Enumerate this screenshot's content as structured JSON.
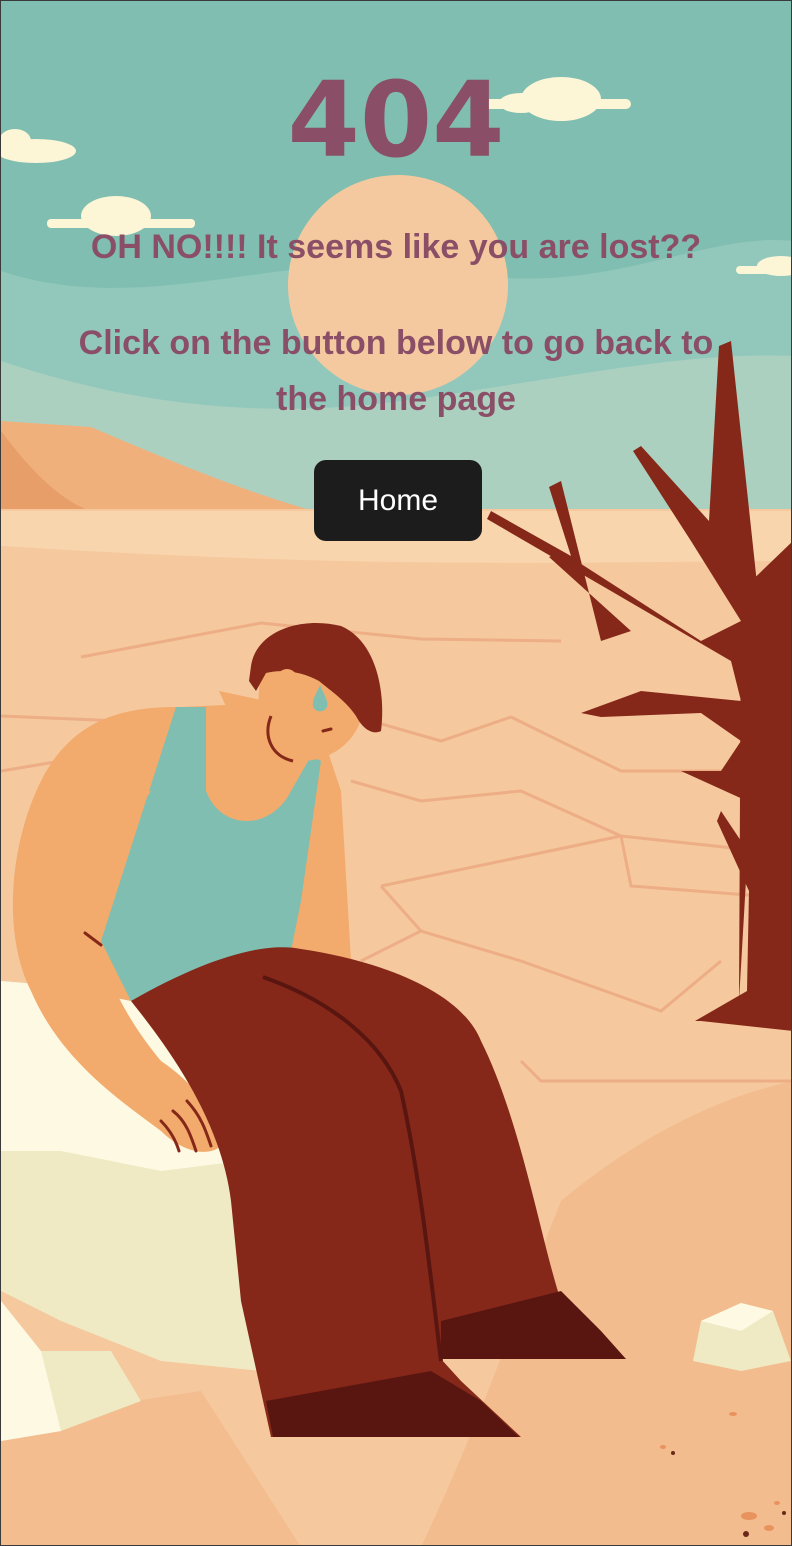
{
  "error": {
    "code": "404",
    "message_lost": "OH NO!!!! It seems like you are lost??",
    "message_instruction": "Click on the button below to go back to the home page"
  },
  "actions": {
    "home_label": "Home"
  },
  "illustration": {
    "subject": "sad-man-sitting-in-desert",
    "colors": {
      "sky": "#7fbeb0",
      "sun": "#f5c9a0",
      "sand": "#f5c89d",
      "dune": "#f0b07c",
      "shirt": "#7fbeb0",
      "pants": "#852819",
      "skin": "#f2ab6c",
      "hair": "#852819",
      "tree": "#852819",
      "rock": "#efe9c4",
      "text": "#8a4f66",
      "button": "#1c1c1c"
    }
  }
}
